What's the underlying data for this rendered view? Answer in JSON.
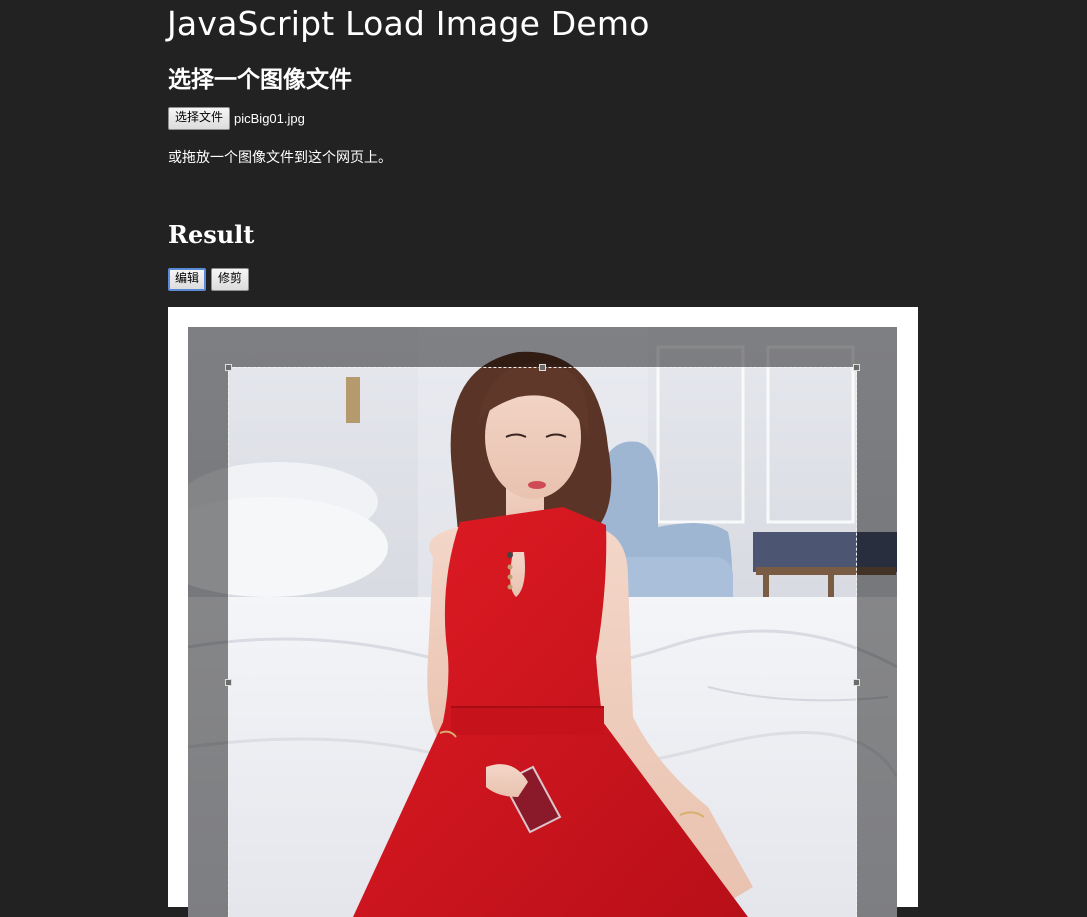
{
  "page": {
    "title": "JavaScript Load Image Demo",
    "subtitle": "选择一个图像文件",
    "file_button_label": "选择文件",
    "file_name": "picBig01.jpg",
    "drop_hint": "或拖放一个图像文件到这个网页上。",
    "result_heading": "Result",
    "edit_button_label": "编辑",
    "crop_button_label": "修剪"
  },
  "colors": {
    "background": "#222222",
    "text": "#ffffff",
    "panel": "#ffffff",
    "dress": "#d8141e",
    "focus_ring": "#5b8bd6"
  },
  "icons": {
    "crop_handles": "square-handle"
  }
}
